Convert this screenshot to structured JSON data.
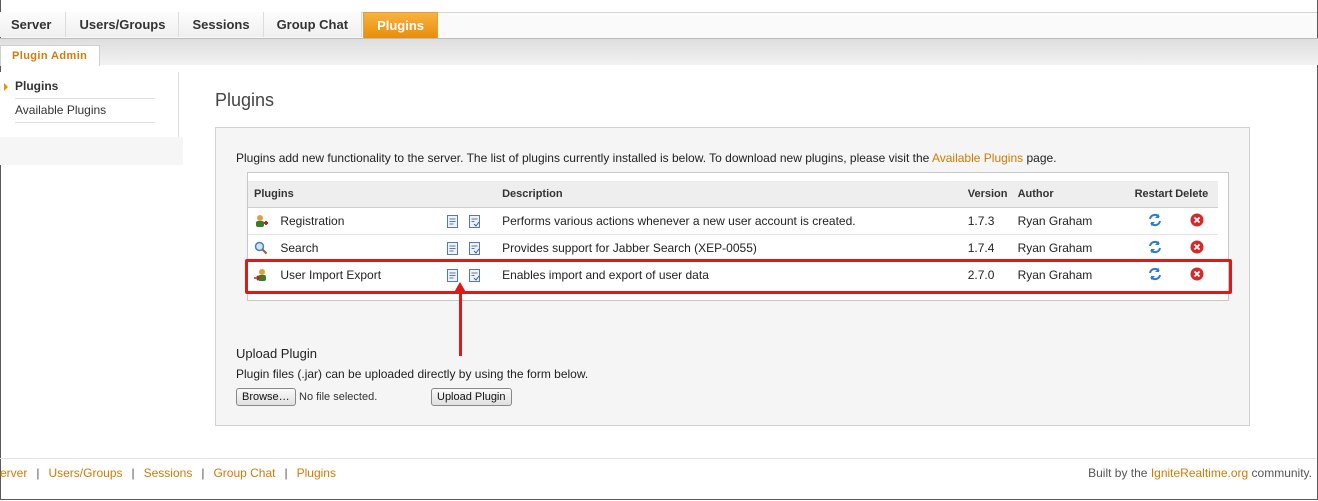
{
  "tabs": [
    "Server",
    "Users/Groups",
    "Sessions",
    "Group Chat",
    "Plugins"
  ],
  "subtab": "Plugin Admin",
  "sidebar": {
    "items": [
      {
        "label": "Plugins"
      },
      {
        "label": "Available Plugins"
      }
    ]
  },
  "page_title": "Plugins",
  "intro": {
    "text_before": "Plugins add new functionality to the server. The list of plugins currently installed is below. To download new plugins, please visit the ",
    "link": "Available Plugins",
    "text_after": " page."
  },
  "table": {
    "headers": {
      "plugins": "Plugins",
      "description": "Description",
      "version": "Version",
      "author": "Author",
      "restart": "Restart",
      "delete": "Delete"
    },
    "rows": [
      {
        "name": "Registration",
        "description": "Performs various actions whenever a new user account is created.",
        "version": "1.7.3",
        "author": "Ryan Graham"
      },
      {
        "name": "Search",
        "description": "Provides support for Jabber Search (XEP-0055)",
        "version": "1.7.4",
        "author": "Ryan Graham"
      },
      {
        "name": "User Import Export",
        "description": "Enables import and export of user data",
        "version": "2.7.0",
        "author": "Ryan Graham"
      }
    ]
  },
  "upload": {
    "title": "Upload Plugin",
    "desc": "Plugin files (.jar) can be uploaded directly by using the form below.",
    "browse": "Browse…",
    "no_file": "No file selected.",
    "submit": "Upload Plugin"
  },
  "footer": {
    "links": [
      "erver",
      "Users/Groups",
      "Sessions",
      "Group Chat",
      "Plugins"
    ],
    "built_before": "Built by the ",
    "built_link": "IgniteRealtime.org",
    "built_after": " community."
  },
  "colors": {
    "accent": "#d17a05",
    "highlight": "#dd1a1a",
    "active_tab": "#f0a020"
  },
  "icons": [
    "registration-icon",
    "search-icon",
    "user-import-icon",
    "readme-icon",
    "changelog-icon",
    "restart-icon",
    "delete-icon"
  ]
}
